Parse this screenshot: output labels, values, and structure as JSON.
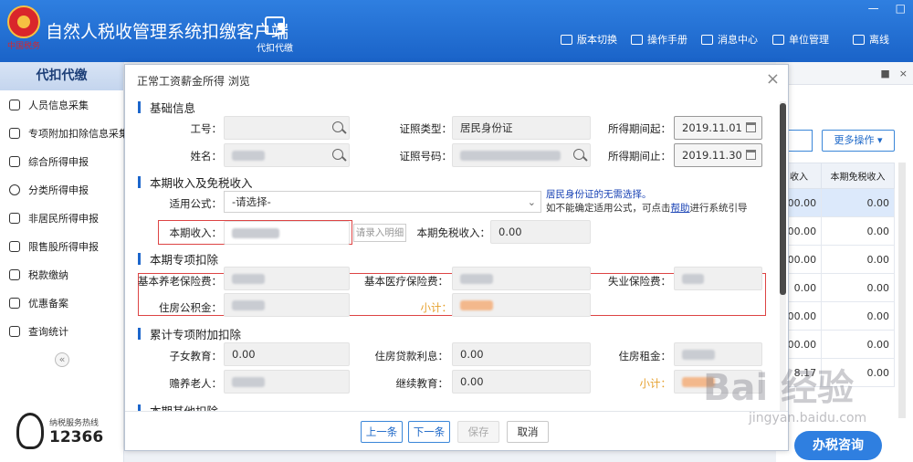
{
  "app": {
    "title": "自然人税收管理系统扣缴客户端",
    "logo_text": "中国税务",
    "module_label": "代扣代缴",
    "window_controls": [
      "—",
      "□"
    ]
  },
  "top_nav": [
    {
      "label": "版本切换",
      "icon": "switch-icon"
    },
    {
      "label": "操作手册",
      "icon": "manual-icon"
    },
    {
      "label": "消息中心",
      "icon": "mail-icon"
    },
    {
      "label": "单位管理",
      "icon": "building-icon"
    },
    {
      "label": "离线",
      "icon": "offline-icon"
    }
  ],
  "sidebar": {
    "header": "代扣代缴",
    "items": [
      {
        "label": "人员信息采集",
        "icon": "person-icon"
      },
      {
        "label": "专项附加扣除信息采集",
        "icon": "list-icon"
      },
      {
        "label": "综合所得申报",
        "icon": "layers-icon"
      },
      {
        "label": "分类所得申报",
        "icon": "pie-icon"
      },
      {
        "label": "非居民所得申报",
        "icon": "user-icon"
      },
      {
        "label": "限售股所得申报",
        "icon": "bar-icon"
      },
      {
        "label": "税款缴纳",
        "icon": "folder-icon"
      },
      {
        "label": "优惠备案",
        "icon": "file-icon"
      },
      {
        "label": "查询统计",
        "icon": "search-list-icon"
      }
    ],
    "collapse_glyph": "«",
    "hotline_label": "纳税服务热线",
    "hotline_number": "12366"
  },
  "right_panel": {
    "tab_icons": [
      "■",
      "×"
    ],
    "more_button": "更多操作",
    "columns": [
      "收入",
      "本期免税收入"
    ],
    "rows": [
      [
        "00.00",
        "0.00"
      ],
      [
        "00.00",
        "0.00"
      ],
      [
        "00.00",
        "0.00"
      ],
      [
        "0.00",
        "0.00"
      ],
      [
        "00.00",
        "0.00"
      ],
      [
        "00.00",
        "0.00"
      ],
      [
        "8.17",
        "0.00"
      ]
    ],
    "consult_button": "办税咨询"
  },
  "modal": {
    "title": "正常工资薪金所得 浏览",
    "sections": {
      "basic": "基础信息",
      "income": "本期收入及免税收入",
      "special": "本期专项扣除",
      "cumulative": "累计专项附加扣除",
      "other": "本期其他扣除"
    },
    "basic": {
      "id_label": "工号：",
      "name_label": "姓名：",
      "cert_type_label": "证照类型：",
      "cert_type_value": "居民身份证",
      "cert_no_label": "证照号码：",
      "period_start_label": "所得期间起：",
      "period_start_value": "2019.11.01",
      "period_end_label": "所得期间止：",
      "period_end_value": "2019.11.30"
    },
    "income": {
      "formula_label": "适用公式：",
      "formula_value": "-请选择-",
      "hint_blue": "居民身份证的无需选择。",
      "hint_gray_pre": "如不能确定适用公式，可点击",
      "hint_link": "帮助",
      "hint_gray_post": "进行系统引导",
      "current_income_label": "本期收入：",
      "detail_button": "请录入明细",
      "tax_free_label": "本期免税收入：",
      "tax_free_value": "0.00"
    },
    "special": {
      "pension_label": "基本养老保险费：",
      "medical_label": "基本医疗保险费：",
      "unemployment_label": "失业保险费：",
      "housing_fund_label": "住房公积金：",
      "subtotal_label": "小计："
    },
    "cumulative": {
      "children_label": "子女教育：",
      "children_value": "0.00",
      "loan_label": "住房贷款利息：",
      "loan_value": "0.00",
      "rent_label": "住房租金：",
      "elderly_label": "赡养老人：",
      "continuing_label": "继续教育：",
      "continuing_value": "0.00",
      "subtotal_label": "小计："
    },
    "footer": {
      "prev": "上一条",
      "next": "下一条",
      "save": "保存",
      "cancel": "取消"
    },
    "close_glyph": "×"
  },
  "watermark": {
    "brand": "Bai 经验",
    "url": "jingyan.baidu.com"
  },
  "colors": {
    "accent": "#1d68c8",
    "topbar": "#2f7fe0",
    "highlight_box": "#dd4444",
    "subtotal": "#e6a02c"
  }
}
